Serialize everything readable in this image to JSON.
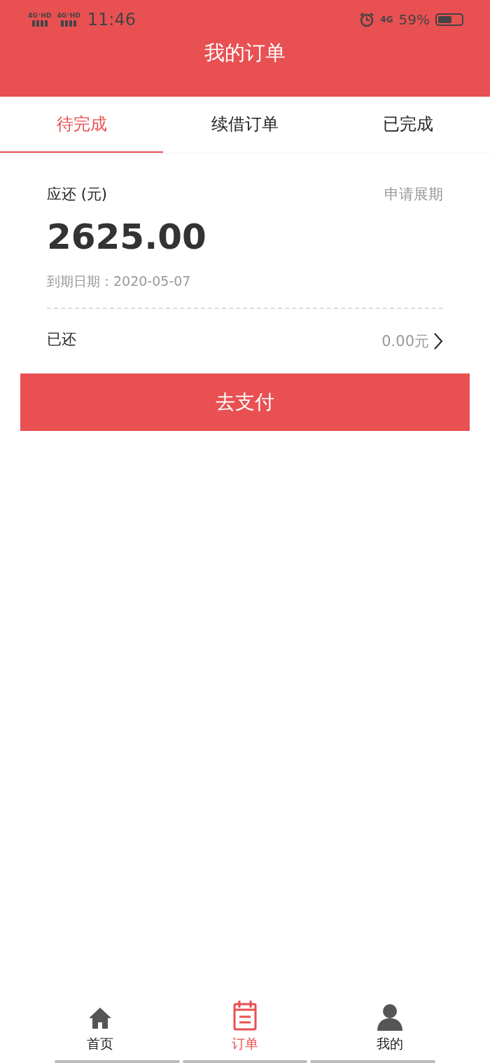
{
  "status_bar": {
    "network_1": "4G⁺HD",
    "network_2": "4G⁺HD",
    "time": "11:46",
    "network_3": "4G",
    "battery": "59%"
  },
  "header": {
    "title": "我的订单"
  },
  "tabs": [
    {
      "label": "待完成",
      "selected": true
    },
    {
      "label": "续借订单",
      "selected": false
    },
    {
      "label": "已完成",
      "selected": false
    }
  ],
  "order": {
    "due_label": "应还 (元)",
    "extend_link": "申请展期",
    "amount": "2625.00",
    "due_date": "到期日期：2020-05-07",
    "paid_label": "已还",
    "paid_value": "0.00元"
  },
  "pay_button": "去支付",
  "bottom_nav": [
    {
      "label": "首页",
      "kind": "home",
      "selected": false
    },
    {
      "label": "订单",
      "kind": "orders",
      "selected": true
    },
    {
      "label": "我的",
      "kind": "profile",
      "selected": false
    }
  ]
}
